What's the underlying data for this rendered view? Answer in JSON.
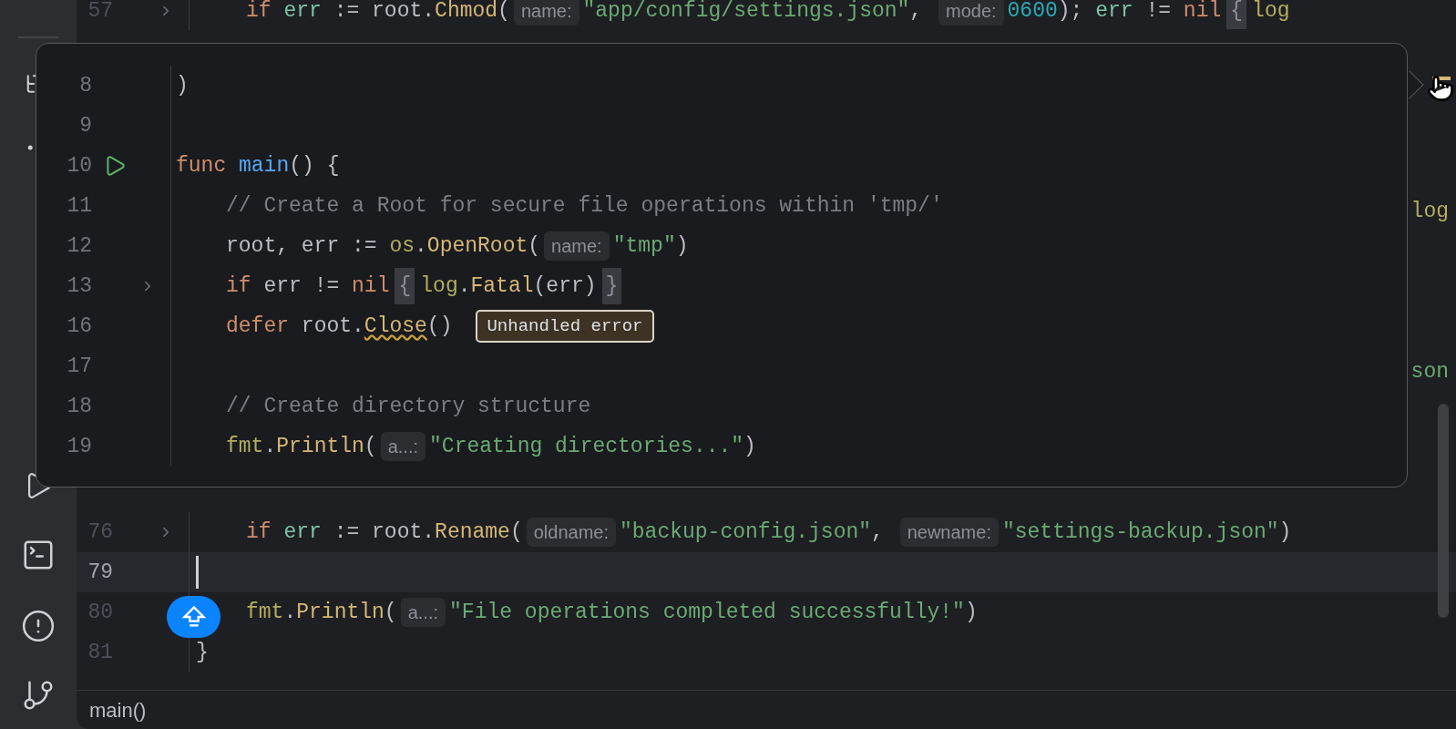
{
  "editor": {
    "lines": [
      {
        "kind": "code",
        "number": "57",
        "fold": true,
        "current": false,
        "indented": true,
        "tokens": [
          {
            "kind": "kw",
            "text": "if "
          },
          {
            "kind": "var",
            "text": "err"
          },
          {
            "kind": "plain",
            "text": " := root."
          },
          {
            "kind": "method",
            "text": "Chmod"
          },
          {
            "kind": "plain",
            "text": "("
          },
          {
            "kind": "hint",
            "text": "name:"
          },
          {
            "kind": "str",
            "text": "\"app/config/settings.json\""
          },
          {
            "kind": "plain",
            "text": ", "
          },
          {
            "kind": "hint",
            "text": "mode:"
          },
          {
            "kind": "num",
            "text": "0600"
          },
          {
            "kind": "plain",
            "text": "); "
          },
          {
            "kind": "var",
            "text": "err"
          },
          {
            "kind": "plain",
            "text": " != "
          },
          {
            "kind": "kw",
            "text": "nil"
          },
          {
            "kind": "fold_brace",
            "text": "{"
          },
          {
            "kind": "pkg",
            "text": "log"
          }
        ]
      },
      {
        "kind": "covered"
      },
      {
        "kind": "covered"
      },
      {
        "kind": "covered"
      },
      {
        "kind": "covered"
      },
      {
        "kind": "covered",
        "tokens": [
          {
            "kind": "pkg",
            "text": "log"
          }
        ]
      },
      {
        "kind": "covered"
      },
      {
        "kind": "covered"
      },
      {
        "kind": "covered"
      },
      {
        "kind": "covered",
        "tokens": [
          {
            "kind": "str",
            "text": "son"
          }
        ]
      },
      {
        "kind": "covered"
      },
      {
        "kind": "covered"
      },
      {
        "kind": "covered"
      },
      {
        "kind": "code",
        "number": "76",
        "fold": true,
        "current": false,
        "indented": true,
        "tokens": [
          {
            "kind": "kw",
            "text": "if "
          },
          {
            "kind": "var",
            "text": "err"
          },
          {
            "kind": "plain",
            "text": " := root."
          },
          {
            "kind": "method",
            "text": "Rename"
          },
          {
            "kind": "plain",
            "text": "("
          },
          {
            "kind": "hint",
            "text": "oldname:"
          },
          {
            "kind": "str",
            "text": "\"backup-config.json\""
          },
          {
            "kind": "plain",
            "text": ", "
          },
          {
            "kind": "hint",
            "text": "newname:"
          },
          {
            "kind": "str",
            "text": "\"settings-backup.json\""
          },
          {
            "kind": "plain",
            "text": ")"
          }
        ]
      },
      {
        "kind": "code",
        "number": "79",
        "fold": false,
        "current": true
      },
      {
        "kind": "code",
        "number": "80",
        "fold": false,
        "current": false,
        "indented": true,
        "tokens": [
          {
            "kind": "pkg",
            "text": "fmt"
          },
          {
            "kind": "plain",
            "text": "."
          },
          {
            "kind": "method",
            "text": "Println"
          },
          {
            "kind": "plain",
            "text": "("
          },
          {
            "kind": "hint",
            "text": "a...:"
          },
          {
            "kind": "str",
            "text": "\"File operations completed successfully!\""
          },
          {
            "kind": "plain",
            "text": ")"
          }
        ]
      },
      {
        "kind": "code",
        "number": "81",
        "fold": false,
        "current": false,
        "indented": false,
        "tokens": [
          {
            "kind": "plain",
            "text": "}"
          }
        ]
      }
    ]
  },
  "popup": {
    "lines": [
      {
        "number": "8",
        "run": false,
        "fold": false,
        "indented": false,
        "tokens": [
          {
            "kind": "plain",
            "text": ")"
          }
        ]
      },
      {
        "number": "9",
        "run": false,
        "fold": false
      },
      {
        "number": "10",
        "run": true,
        "fold": false,
        "indented": false,
        "tokens": [
          {
            "kind": "kw",
            "text": "func "
          },
          {
            "kind": "fn",
            "text": "main"
          },
          {
            "kind": "plain",
            "text": "() {"
          }
        ]
      },
      {
        "number": "11",
        "run": false,
        "fold": false,
        "indented": true,
        "tokens": [
          {
            "kind": "cmt",
            "text": "// Create a Root for secure file operations within 'tmp/'"
          }
        ]
      },
      {
        "number": "12",
        "run": false,
        "fold": false,
        "indented": true,
        "tokens": [
          {
            "kind": "plain",
            "text": "root, err := "
          },
          {
            "kind": "pkg",
            "text": "os"
          },
          {
            "kind": "plain",
            "text": "."
          },
          {
            "kind": "method",
            "text": "OpenRoot"
          },
          {
            "kind": "plain",
            "text": "("
          },
          {
            "kind": "hint",
            "text": "name:"
          },
          {
            "kind": "str",
            "text": "\"tmp\""
          },
          {
            "kind": "plain",
            "text": ")"
          }
        ]
      },
      {
        "number": "13",
        "run": false,
        "fold": true,
        "indented": true,
        "tokens": [
          {
            "kind": "kw",
            "text": "if "
          },
          {
            "kind": "plain",
            "text": "err != "
          },
          {
            "kind": "kw",
            "text": "nil"
          },
          {
            "kind": "fold_brace",
            "text": "{"
          },
          {
            "kind": "pkg",
            "text": "log"
          },
          {
            "kind": "plain",
            "text": "."
          },
          {
            "kind": "method",
            "text": "Fatal"
          },
          {
            "kind": "plain",
            "text": "(err)"
          },
          {
            "kind": "fold_brace",
            "text": "}"
          }
        ]
      },
      {
        "number": "16",
        "run": false,
        "fold": false,
        "indented": true,
        "tokens": [
          {
            "kind": "kw",
            "text": "defer "
          },
          {
            "kind": "plain",
            "text": "root."
          },
          {
            "kind": "warned",
            "text": "Close"
          },
          {
            "kind": "plain",
            "text": "()"
          },
          {
            "kind": "inlay_warning",
            "text": "Unhandled error"
          }
        ]
      },
      {
        "number": "17",
        "run": false,
        "fold": false
      },
      {
        "number": "18",
        "run": false,
        "fold": false,
        "indented": true,
        "tokens": [
          {
            "kind": "cmt",
            "text": "// Create directory structure"
          }
        ]
      },
      {
        "number": "19",
        "run": false,
        "fold": false,
        "indented": true,
        "tokens": [
          {
            "kind": "pkg",
            "text": "fmt"
          },
          {
            "kind": "plain",
            "text": "."
          },
          {
            "kind": "method",
            "text": "Println"
          },
          {
            "kind": "plain",
            "text": "("
          },
          {
            "kind": "hint",
            "text": "a...:"
          },
          {
            "kind": "str",
            "text": "\"Creating directories...\""
          },
          {
            "kind": "plain",
            "text": ")"
          }
        ]
      }
    ]
  },
  "breadcrumb": "main()"
}
